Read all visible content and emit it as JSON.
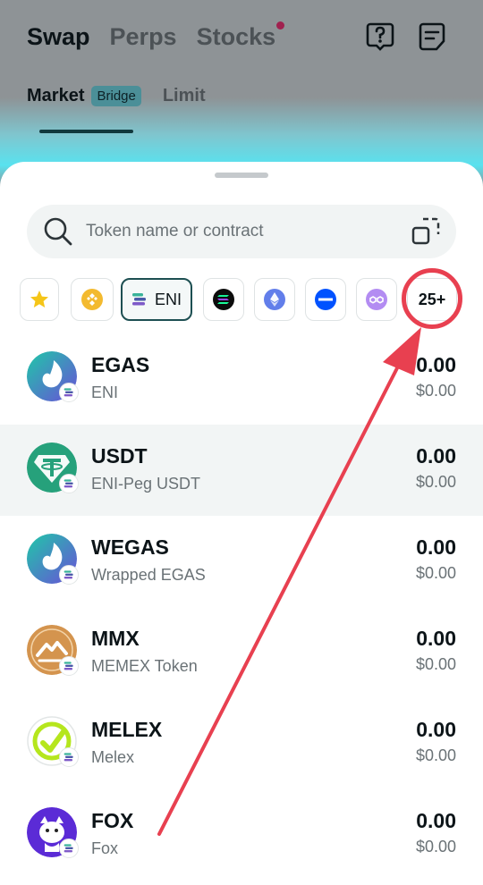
{
  "header": {
    "mode_tabs": [
      {
        "label": "Swap",
        "active": true
      },
      {
        "label": "Perps",
        "active": false
      },
      {
        "label": "Stocks",
        "active": false,
        "notification": true
      }
    ],
    "icons": [
      "help-icon",
      "orders-icon"
    ],
    "sub_tabs": {
      "market": "Market",
      "bridge_badge": "Bridge",
      "limit": "Limit"
    }
  },
  "search": {
    "placeholder": "Token name or contract",
    "icon": "search-icon",
    "right_icon": "scan-icon"
  },
  "chains": {
    "items": [
      {
        "icon": "star-icon",
        "label": ""
      },
      {
        "icon": "bnb-chain-icon",
        "label": ""
      },
      {
        "icon": "eni-chain-icon",
        "label": "ENI",
        "selected": true
      },
      {
        "icon": "solana-icon",
        "label": ""
      },
      {
        "icon": "ethereum-icon",
        "label": ""
      },
      {
        "icon": "base-chain-icon",
        "label": ""
      },
      {
        "icon": "polygon-icon",
        "label": ""
      }
    ],
    "more_label": "25+"
  },
  "tokens": [
    {
      "symbol": "EGAS",
      "name": "ENI",
      "balance": "0.00",
      "usd": "$0.00"
    },
    {
      "symbol": "USDT",
      "name": "ENI-Peg USDT",
      "balance": "0.00",
      "usd": "$0.00"
    },
    {
      "symbol": "WEGAS",
      "name": "Wrapped EGAS",
      "balance": "0.00",
      "usd": "$0.00"
    },
    {
      "symbol": "MMX",
      "name": "MEMEX Token",
      "balance": "0.00",
      "usd": "$0.00"
    },
    {
      "symbol": "MELEX",
      "name": "Melex",
      "balance": "0.00",
      "usd": "$0.00"
    },
    {
      "symbol": "FOX",
      "name": "Fox",
      "balance": "0.00",
      "usd": "$0.00"
    }
  ],
  "colors": {
    "accent": "#11393d",
    "annotation": "#e84050",
    "usdt_green": "#26a17b"
  }
}
